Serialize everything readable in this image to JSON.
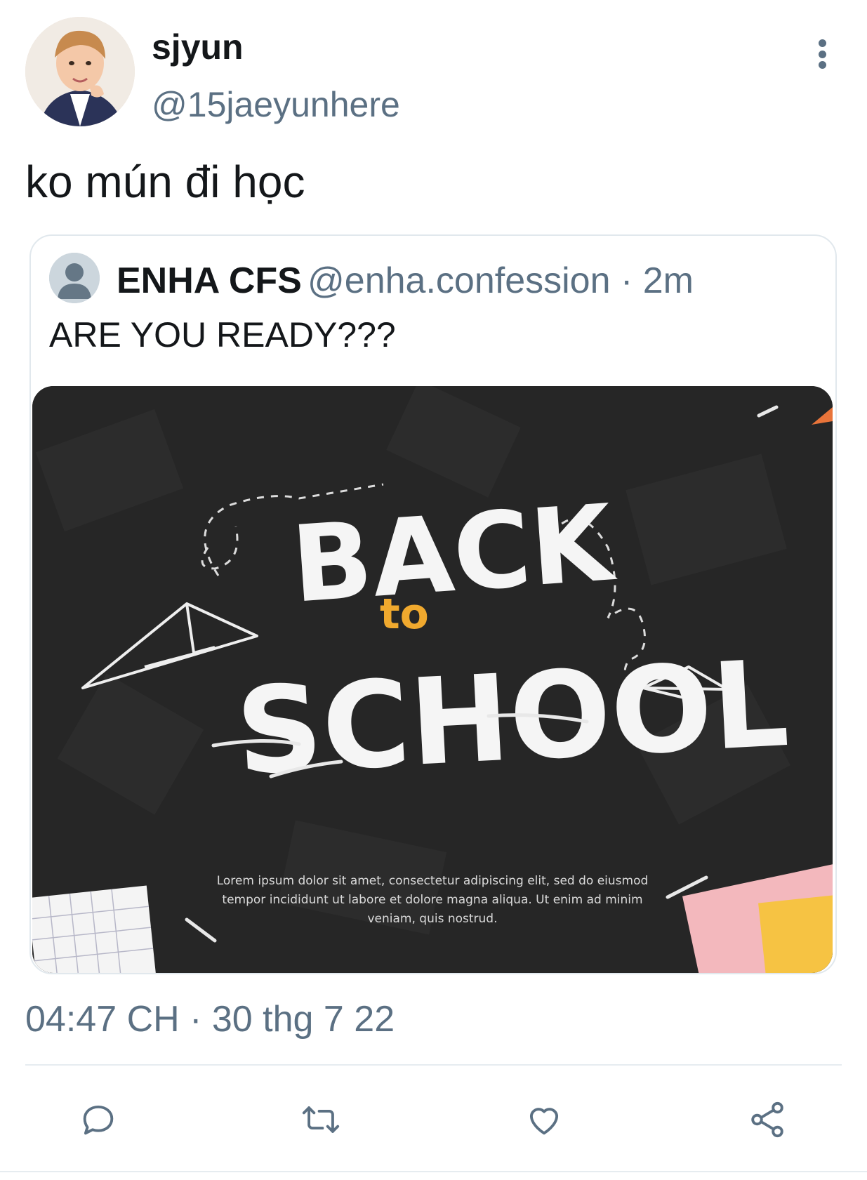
{
  "author": {
    "display_name": "sjyun",
    "handle": "@15jaeyunhere"
  },
  "tweet": {
    "text": "ko mún đi học",
    "timestamp": "04:47 CH · 30 thg 7 22"
  },
  "quoted": {
    "display_name": "ENHA CFS",
    "meta": "@enha.confession · 2m",
    "text": "ARE YOU READY???",
    "image": {
      "lorem_text": "Lorem ipsum dolor sit amet, consectetur adipiscing elit, sed do eiusmod tempor incididunt ut labore et dolore magna aliqua. Ut enim ad minim veniam, quis nostrud."
    }
  },
  "actions": [
    {
      "icon": "reply-icon"
    },
    {
      "icon": "retweet-icon"
    },
    {
      "icon": "like-icon"
    },
    {
      "icon": "share-icon"
    }
  ],
  "colors": {
    "text_primary": "#14171a",
    "text_secondary": "#5b7083",
    "border": "#e1e8ed",
    "chalkboard": "#262626",
    "accent_orange": "#f0a92e"
  }
}
